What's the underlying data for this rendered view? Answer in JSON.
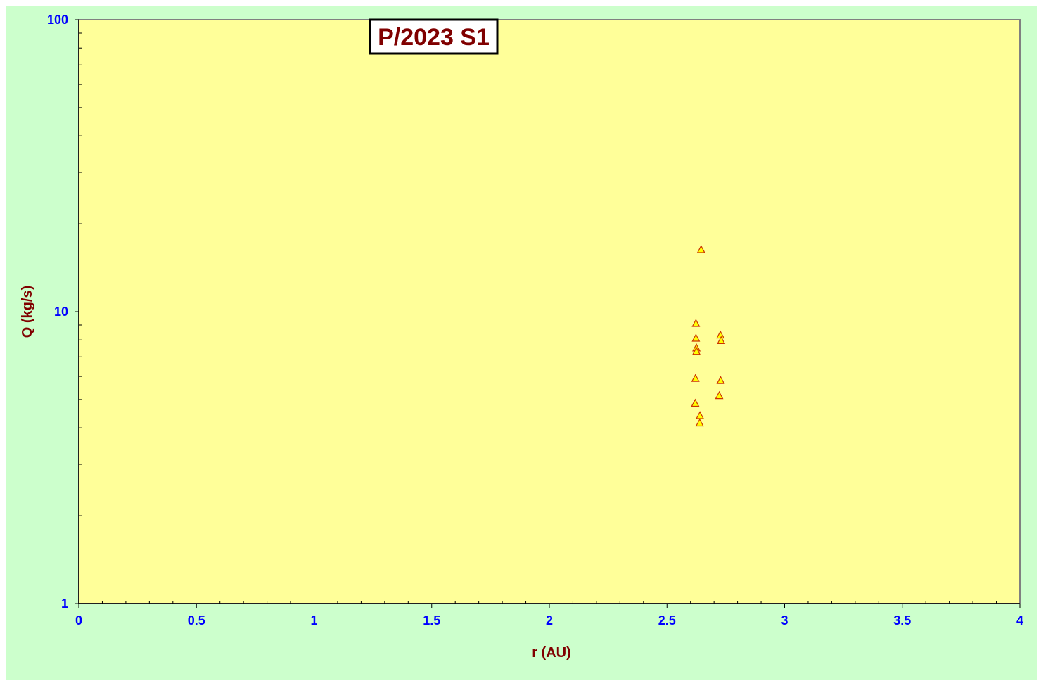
{
  "chart_data": {
    "type": "scatter",
    "title": "P/2023 S1",
    "xlabel": "r (AU)",
    "ylabel": "Q (kg/s)",
    "xlim": [
      0,
      4
    ],
    "ylim": [
      1,
      100
    ],
    "y_scale": "log",
    "x_ticks": [
      "0",
      "0.5",
      "1",
      "1.5",
      "2",
      "2.5",
      "3",
      "3.5",
      "4"
    ],
    "y_ticks": [
      "1",
      "10",
      "100"
    ],
    "grid": false,
    "legend": "none",
    "marker": "triangle",
    "series": [
      {
        "points": [
          {
            "x": 2.645,
            "y": 16.3
          },
          {
            "x": 2.623,
            "y": 9.1
          },
          {
            "x": 2.623,
            "y": 8.1
          },
          {
            "x": 2.625,
            "y": 7.5
          },
          {
            "x": 2.625,
            "y": 7.3
          },
          {
            "x": 2.621,
            "y": 5.9
          },
          {
            "x": 2.62,
            "y": 4.85
          },
          {
            "x": 2.64,
            "y": 4.4
          },
          {
            "x": 2.639,
            "y": 4.15
          },
          {
            "x": 2.727,
            "y": 8.3
          },
          {
            "x": 2.73,
            "y": 7.95
          },
          {
            "x": 2.728,
            "y": 5.8
          },
          {
            "x": 2.722,
            "y": 5.15
          }
        ]
      }
    ],
    "colors": {
      "outer_background": "#ccffcc",
      "plot_background": "#ffff99",
      "marker_fill": "#ffff00",
      "marker_stroke": "#cc3300",
      "tick_text": "#0000ff",
      "axis_label_text": "#800000",
      "title_text": "#800000"
    }
  }
}
